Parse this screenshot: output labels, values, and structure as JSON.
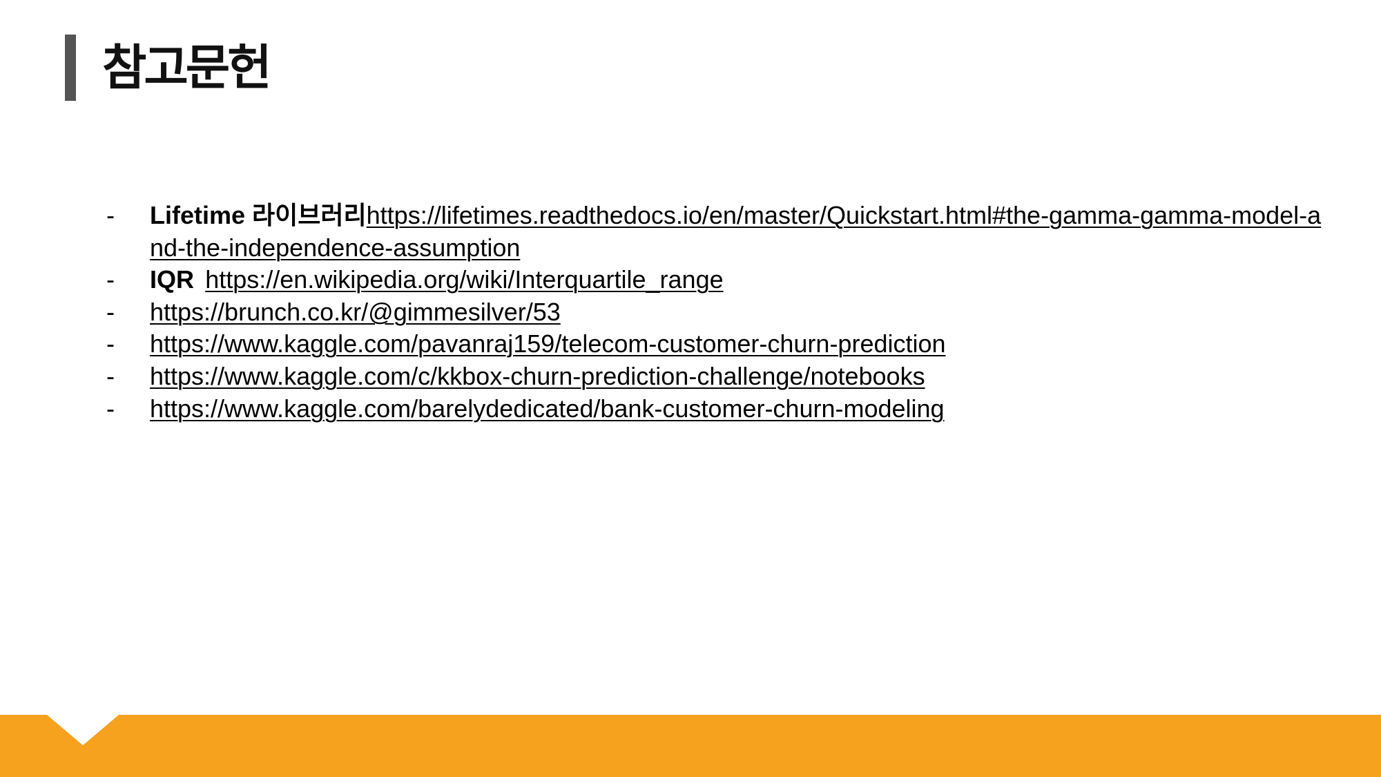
{
  "slide": {
    "title": "참고문헌"
  },
  "colors": {
    "accent_bar": "#555555",
    "footer": "#F6A21E",
    "notch": "#FFFFFF"
  },
  "references": [
    {
      "bullet": "-",
      "label": "Lifetime 라이브러리",
      "url": "https://lifetimes.readthedocs.io/en/master/Quickstart.html#the-gamma-gamma-model-and-the-independence-assumption"
    },
    {
      "bullet": "-",
      "label": "IQR",
      "url": "https://en.wikipedia.org/wiki/Interquartile_range"
    },
    {
      "bullet": "-",
      "url": "https://brunch.co.kr/@gimmesilver/53"
    },
    {
      "bullet": "-",
      "url": "https://www.kaggle.com/pavanraj159/telecom-customer-churn-prediction"
    },
    {
      "bullet": "-",
      "url": "https://www.kaggle.com/c/kkbox-churn-prediction-challenge/notebooks"
    },
    {
      "bullet": "-",
      "url": "https://www.kaggle.com/barelydedicated/bank-customer-churn-modeling"
    }
  ]
}
